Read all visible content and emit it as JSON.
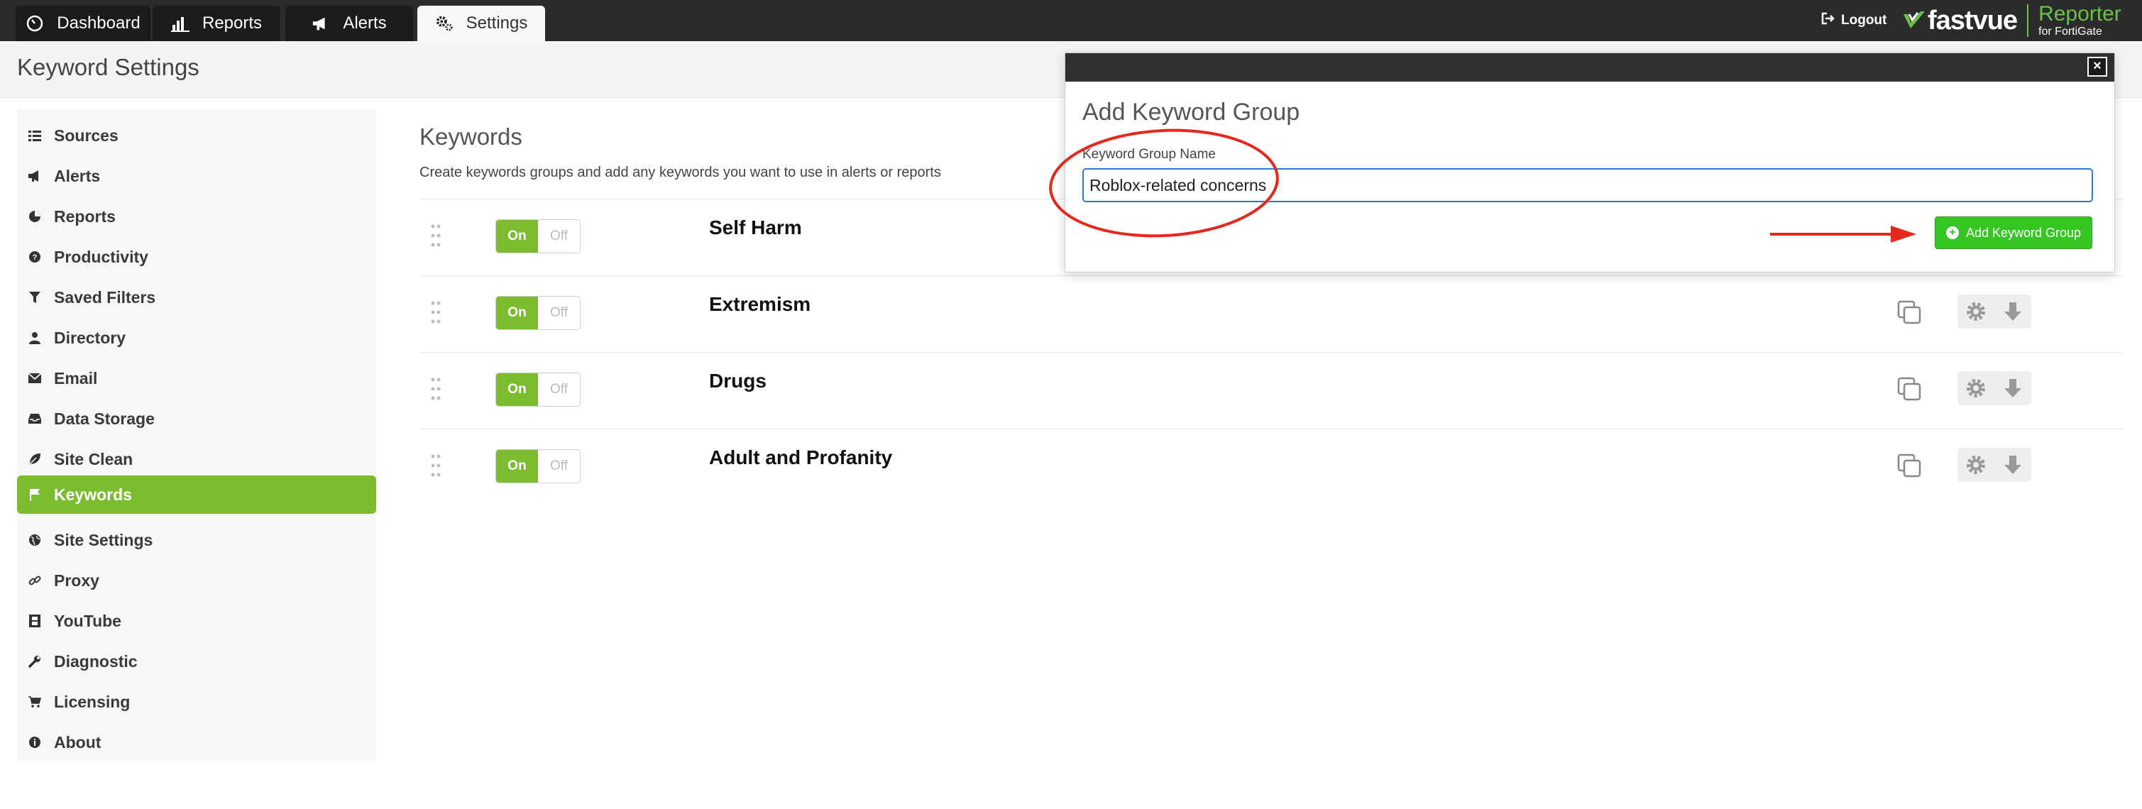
{
  "nav": {
    "tabs": [
      {
        "label": "Dashboard",
        "icon": "dashboard-gauge-icon"
      },
      {
        "label": "Reports",
        "icon": "bar-chart-icon"
      },
      {
        "label": "Alerts",
        "icon": "megaphone-icon"
      },
      {
        "label": "Settings",
        "icon": "gears-icon",
        "active": true
      }
    ],
    "logout_label": "Logout",
    "brand": {
      "name": "fastvue",
      "product": "Reporter",
      "product_sub": "for FortiGate",
      "accent": "#6cc04a"
    }
  },
  "page": {
    "title": "Keyword Settings"
  },
  "sidebar": {
    "items": [
      {
        "label": "Sources",
        "icon": "list-icon"
      },
      {
        "label": "Alerts",
        "icon": "megaphone-icon"
      },
      {
        "label": "Reports",
        "icon": "pie-chart-icon"
      },
      {
        "label": "Productivity",
        "icon": "question-circle-icon"
      },
      {
        "label": "Saved Filters",
        "icon": "funnel-icon"
      },
      {
        "label": "Directory",
        "icon": "user-icon"
      },
      {
        "label": "Email",
        "icon": "envelope-icon"
      },
      {
        "label": "Data Storage",
        "icon": "inbox-icon"
      },
      {
        "label": "Site Clean",
        "icon": "leaf-icon"
      },
      {
        "label": "Keywords",
        "icon": "flag-icon",
        "active": true
      },
      {
        "label": "Site Settings",
        "icon": "globe-icon"
      },
      {
        "label": "Proxy",
        "icon": "link-icon"
      },
      {
        "label": "YouTube",
        "icon": "film-icon"
      },
      {
        "label": "Diagnostic",
        "icon": "wrench-icon"
      },
      {
        "label": "Licensing",
        "icon": "cart-icon"
      },
      {
        "label": "About",
        "icon": "info-circle-icon"
      }
    ],
    "active_color": "#7bbd2e"
  },
  "main": {
    "title": "Keywords",
    "description": "Create keywords groups and add any keywords you want to use in alerts or reports",
    "toggle": {
      "on_label": "On",
      "off_label": "Off"
    },
    "groups": [
      {
        "name": "Self Harm",
        "state": "On"
      },
      {
        "name": "Extremism",
        "state": "On"
      },
      {
        "name": "Drugs",
        "state": "On"
      },
      {
        "name": "Adult and Profanity",
        "state": "On"
      }
    ]
  },
  "modal": {
    "title": "Add Keyword Group",
    "close_label": "×",
    "field_label": "Keyword Group Name",
    "field_value": "Roblox-related concerns",
    "submit_label": "Add Keyword Group",
    "submit_color": "#35c624"
  },
  "annotations": {
    "highlight_color": "#e5271d"
  }
}
